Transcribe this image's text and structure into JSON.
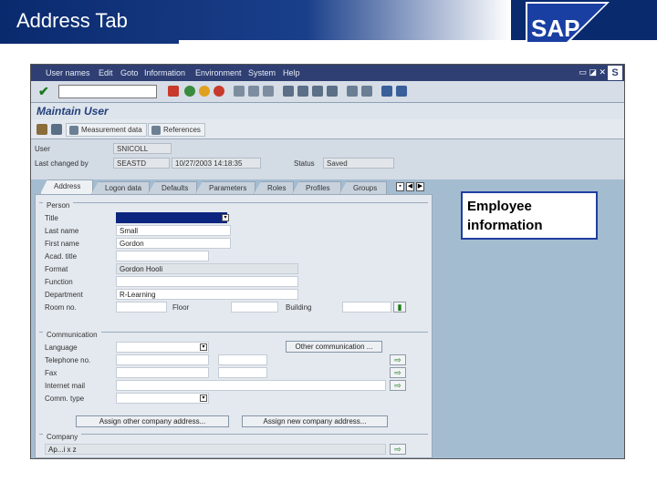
{
  "slide": {
    "title": "Address Tab"
  },
  "logo": {
    "text": "SAP"
  },
  "callout": {
    "text": "Employee information"
  },
  "window": {
    "menu": [
      "User names",
      "Edit",
      "Goto",
      "Information",
      "Environment",
      "System",
      "Help"
    ],
    "title": "Maintain User",
    "app_toolbar": [
      "Measurement data",
      "References"
    ]
  },
  "header_fields": {
    "user_label": "User",
    "user_value": "SNICOLL",
    "last_changed_label": "Last changed by",
    "last_changed_user": "SEASTD",
    "last_changed_datetime": "10/27/2003 14:18:35",
    "status_label": "Status",
    "status_value": "Saved"
  },
  "tabs": [
    "Address",
    "Logon data",
    "Defaults",
    "Parameters",
    "Roles",
    "Profiles",
    "Groups"
  ],
  "person": {
    "group": "Person",
    "title_label": "Title",
    "last_name_label": "Last name",
    "last_name": "Small",
    "first_name_label": "First name",
    "first_name": "Gordon",
    "acad_title_label": "Acad. title",
    "format_label": "Format",
    "format": "Gordon Hooli",
    "function_label": "Function",
    "department_label": "Department",
    "department": "R-Learning",
    "room_label": "Room no.",
    "floor_label": "Floor",
    "building_label": "Building"
  },
  "communication": {
    "group": "Communication",
    "language_label": "Language",
    "telephone_label": "Telephone no.",
    "fax_label": "Fax",
    "email_label": "Internet mail",
    "comm_type_label": "Comm. type",
    "other_button": "Other communication ..."
  },
  "buttons": {
    "assign_other": "Assign other company address...",
    "assign_new": "Assign new company address..."
  },
  "company": {
    "group": "Company",
    "line": "Ap...i x z"
  },
  "colors": {
    "accent": "#0a2a6e",
    "callout_border": "#1f3fa0",
    "window_bg": "#a4bcd0"
  }
}
